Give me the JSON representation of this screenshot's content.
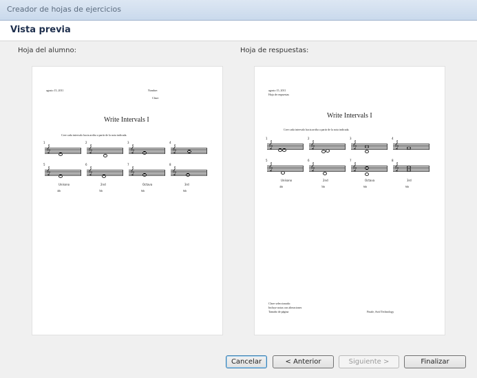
{
  "window": {
    "title": "Creador de hojas de ejercicios"
  },
  "header": {
    "title": "Vista previa"
  },
  "student": {
    "label": "Hoja del alumno:",
    "date": "agosto 15, 2011",
    "name_label": "Nombre:",
    "class_label": "Clase:",
    "title": "Write Intervals I",
    "instructions": "Cree cada intervalo hacia arriba a partir de la nota indicada.",
    "intervals": [
      {
        "num": "1",
        "label": ""
      },
      {
        "num": "2",
        "label": ""
      },
      {
        "num": "3",
        "label": ""
      },
      {
        "num": "4",
        "label": ""
      },
      {
        "num": "5",
        "label": "Unísono"
      },
      {
        "num": "6",
        "label": "2nd"
      },
      {
        "num": "7",
        "label": "Octava"
      },
      {
        "num": "8",
        "label": "3rd"
      }
    ],
    "row3_labels": [
      "4th",
      "5th",
      "6th",
      "6th"
    ]
  },
  "answers": {
    "label": "Hoja de respuestas:",
    "date": "agosto 15, 2011",
    "subtitle": "Hoja de respuestas",
    "title": "Write Intervals I",
    "instructions": "Cree cada intervalo hacia arriba a partir de la nota indicada.",
    "intervals": [
      {
        "num": "1",
        "label": ""
      },
      {
        "num": "2",
        "label": ""
      },
      {
        "num": "3",
        "label": ""
      },
      {
        "num": "4",
        "label": ""
      },
      {
        "num": "5",
        "label": "Unísono"
      },
      {
        "num": "6",
        "label": "2nd"
      },
      {
        "num": "7",
        "label": "Octava"
      },
      {
        "num": "8",
        "label": "3rd"
      }
    ],
    "row3_labels": [
      "4th",
      "5th",
      "6th",
      "6th"
    ],
    "footer_left": [
      "Clave seleccionada: ",
      "Incluye notas con alteraciones",
      "Tamaño de página"
    ],
    "footer_right": "Finale, Avid Technology"
  },
  "buttons": {
    "cancel": "Cancelar",
    "back": "< Anterior",
    "next": "Siguiente >",
    "finish": "Finalizar"
  }
}
